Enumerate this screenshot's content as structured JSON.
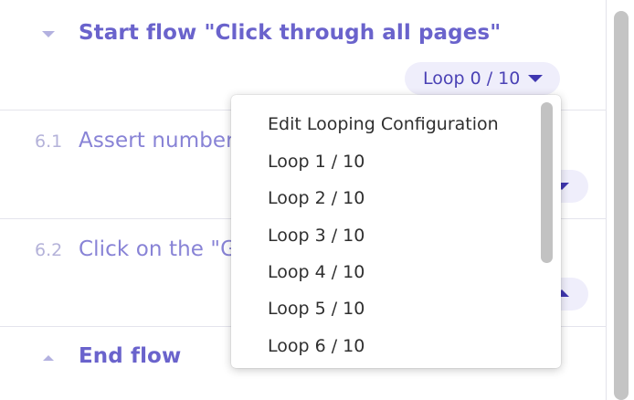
{
  "steps": {
    "start_flow": {
      "title": "Start flow \"Click through all pages\"",
      "loop_label": "Loop 0 / 10"
    },
    "step_6_1": {
      "number": "6.1",
      "title": "Assert number"
    },
    "step_6_2": {
      "number": "6.2",
      "title": "Click on the \"Go"
    },
    "end_flow": {
      "title": "End flow"
    }
  },
  "loop_menu": {
    "items": [
      "Edit Looping Configuration",
      "Loop 1 / 10",
      "Loop 2 / 10",
      "Loop 3 / 10",
      "Loop 4 / 10",
      "Loop 5 / 10",
      "Loop 6 / 10"
    ]
  },
  "colors": {
    "accent": "#6a63cc",
    "pill_background": "#efeefb",
    "pill_text": "#4a41b5",
    "step_number": "#b4b2d9"
  },
  "icons": {
    "collapse": "caret-down-icon",
    "expand": "caret-up-icon",
    "dropdown": "caret-down-icon"
  }
}
